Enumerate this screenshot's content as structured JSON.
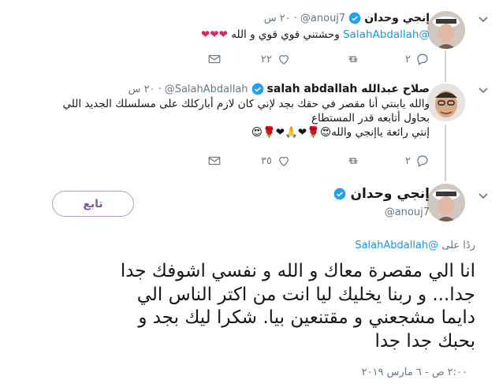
{
  "tweet1": {
    "name": "إنجي وحدان",
    "handle": "@anouj7",
    "time": "٢٠ س",
    "mention": "@SalahAbdallah",
    "text": "وحشتني قوي قوي و الله",
    "hearts": "❤❤❤",
    "replies": "٢",
    "retweets": "",
    "likes": "٢٢"
  },
  "tweet2": {
    "name": "salah abdallah صلاح عبدالله",
    "handle": "@SalahAbdallah",
    "time": "٢٠ س",
    "line1": "والله يابنتي أنا مقصر في حقك بجد لإني كان لازم أباركلك على مسلسلك الجديد اللي",
    "line2": "بحاول أتابعه قدر المستطاع",
    "line3": "إنتي رائعة ياإنجي والله😍🌹❤🙏❤🌹😍",
    "replies": "٢",
    "retweets": "",
    "likes": "٣٥"
  },
  "main": {
    "name": "إنجي وحدان",
    "handle": "@anouj7",
    "follow_label": "تابع",
    "reply_prefix": "ردًا على",
    "reply_mention": "@SalahAbdallah",
    "lines": [
      "انا الي مقصرة معاك و الله و نفسي اشوفك جدا",
      "جدا... و ربنا يخليك ليا انت من اكتر الناس الي",
      "دايما مشجعني و مقتنعين بيا. شكرا ليك بجد و",
      "بحبك جدا جدا"
    ],
    "timestamp": "٢:٠٠ ص - ٦ مارس ٢٠١٩"
  },
  "colors": {
    "accent": "#1b95e0",
    "verified": "#1da1f2",
    "secondary": "#657786",
    "heart": "#e0245e",
    "follow_border": "#b59ad6"
  }
}
